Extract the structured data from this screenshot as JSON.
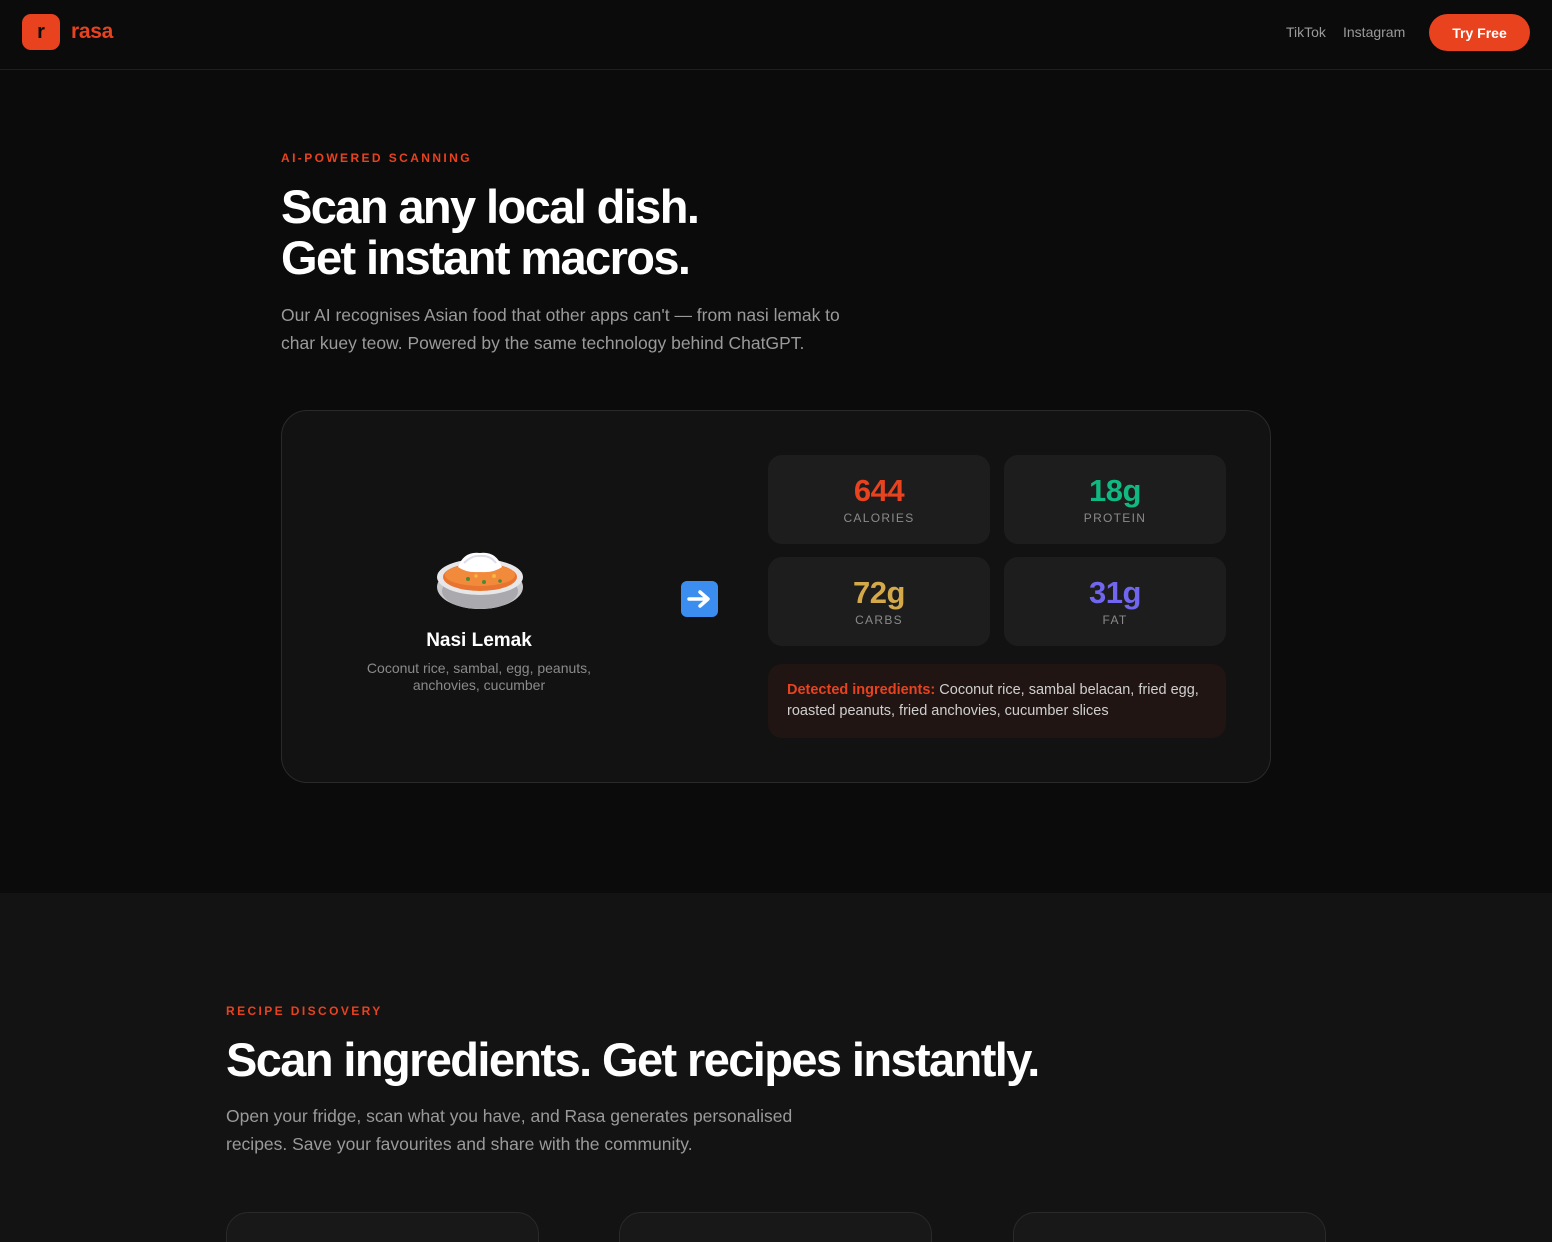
{
  "header": {
    "logo_letter": "r",
    "logo_text": "rasa",
    "nav": {
      "tiktok": "TikTok",
      "instagram": "Instagram"
    },
    "cta": "Try Free"
  },
  "scan_section": {
    "eyebrow": "AI-POWERED SCANNING",
    "title_line1": "Scan any local dish.",
    "title_line2": "Get instant macros.",
    "lead_line1": "Our AI recognises Asian food that other apps can't — from nasi lemak to",
    "lead_line2": "char kuey teow. Powered by the same technology behind ChatGPT.",
    "card": {
      "dish_icon": "curry-rice-bowl-icon",
      "dish_name": "Nasi Lemak",
      "dish_desc_line1": "Coconut rice, sambal, egg, peanuts,",
      "dish_desc_line2": "anchovies, cucumber",
      "arrow_icon": "right-arrow-icon",
      "stats": [
        {
          "value": "644",
          "label": "CALORIES",
          "color": "#e8421f"
        },
        {
          "value": "18g",
          "label": "PROTEIN",
          "color": "#10b981"
        },
        {
          "value": "72g",
          "label": "CARBS",
          "color": "#d4a94a"
        },
        {
          "value": "31g",
          "label": "FAT",
          "color": "#7166f0"
        }
      ],
      "ingredients_label": "Detected ingredients:",
      "ingredients_text": "Coconut rice, sambal belacan, fried egg, roasted peanuts, fried anchovies, cucumber slices"
    }
  },
  "recipe_section": {
    "eyebrow": "RECIPE DISCOVERY",
    "title": "Scan ingredients. Get recipes instantly.",
    "lead_line1": "Open your fridge, scan what you have, and Rasa generates personalised",
    "lead_line2": "recipes. Save your favourites and share with the community."
  },
  "colors": {
    "accent": "#e8421f",
    "background": "#0b0b0b",
    "card": "#121212"
  }
}
